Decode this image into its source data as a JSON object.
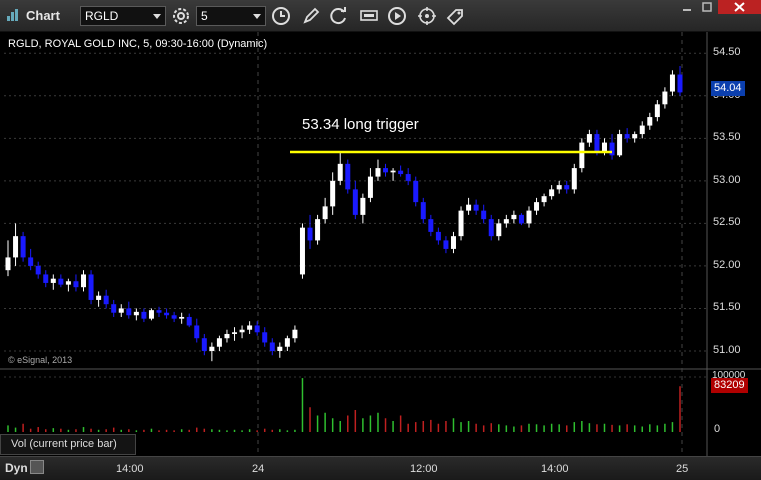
{
  "window": {
    "title": "Chart"
  },
  "toolbar": {
    "symbol": "RGLD",
    "interval": "5"
  },
  "chart": {
    "info": "RGLD, ROYAL GOLD INC, 5, 09:30-16:00 (Dynamic)",
    "annotation": "53.34 long trigger",
    "trigger_price": 53.34,
    "current_price_label": "54.04",
    "copyright": "© eSignal, 2013",
    "price_axis": [
      "54.50",
      "54.00",
      "53.50",
      "53.00",
      "52.50",
      "52.00",
      "51.50",
      "51.00"
    ],
    "time_axis": [
      "14:00",
      "24",
      "12:00",
      "14:00",
      "25"
    ],
    "colors": {
      "up": "#ffffff",
      "down": "#1a1aff",
      "trigger_line": "#ffff00",
      "badge_price": "#0b3fae",
      "badge_volume": "#b00000"
    }
  },
  "volume": {
    "legend": "Vol (current price bar)",
    "axis": [
      "100000",
      "0"
    ],
    "current_label": "83209",
    "colors": {
      "up": "#2fbf2f",
      "down": "#c02020"
    }
  },
  "bottom": {
    "mode": "Dyn"
  },
  "chart_data": {
    "type": "candlestick",
    "series": [
      {
        "name": "RGLD",
        "ohlc": [
          [
            51.95,
            52.3,
            51.88,
            52.1
          ],
          [
            52.1,
            52.5,
            52.0,
            52.35
          ],
          [
            52.35,
            52.4,
            52.05,
            52.1
          ],
          [
            52.1,
            52.2,
            51.95,
            52.0
          ],
          [
            52.0,
            52.05,
            51.85,
            51.9
          ],
          [
            51.9,
            51.95,
            51.75,
            51.8
          ],
          [
            51.8,
            51.9,
            51.72,
            51.85
          ],
          [
            51.85,
            51.9,
            51.75,
            51.78
          ],
          [
            51.78,
            51.85,
            51.7,
            51.82
          ],
          [
            51.82,
            51.9,
            51.7,
            51.75
          ],
          [
            51.75,
            51.95,
            51.7,
            51.9
          ],
          [
            51.9,
            51.95,
            51.55,
            51.6
          ],
          [
            51.6,
            51.7,
            51.52,
            51.65
          ],
          [
            51.65,
            51.72,
            51.5,
            51.55
          ],
          [
            51.55,
            51.6,
            51.4,
            51.45
          ],
          [
            51.45,
            51.55,
            51.4,
            51.5
          ],
          [
            51.5,
            51.58,
            51.38,
            51.42
          ],
          [
            51.42,
            51.5,
            51.36,
            51.46
          ],
          [
            51.46,
            51.5,
            51.34,
            51.38
          ],
          [
            51.38,
            51.5,
            51.36,
            51.48
          ],
          [
            51.48,
            51.52,
            51.4,
            51.45
          ],
          [
            51.45,
            51.5,
            51.38,
            51.42
          ],
          [
            51.42,
            51.46,
            51.34,
            51.38
          ],
          [
            51.38,
            51.45,
            51.32,
            51.4
          ],
          [
            51.4,
            51.44,
            51.28,
            51.3
          ],
          [
            51.3,
            51.38,
            51.1,
            51.15
          ],
          [
            51.15,
            51.2,
            50.95,
            51.0
          ],
          [
            51.0,
            51.1,
            50.88,
            51.05
          ],
          [
            51.05,
            51.18,
            51.0,
            51.15
          ],
          [
            51.15,
            51.25,
            51.1,
            51.2
          ],
          [
            51.2,
            51.28,
            51.12,
            51.22
          ],
          [
            51.22,
            51.3,
            51.15,
            51.25
          ],
          [
            51.25,
            51.35,
            51.2,
            51.3
          ],
          [
            51.3,
            51.35,
            51.18,
            51.22
          ],
          [
            51.22,
            51.28,
            51.05,
            51.1
          ],
          [
            51.1,
            51.15,
            50.95,
            51.0
          ],
          [
            51.0,
            51.1,
            50.92,
            51.05
          ],
          [
            51.05,
            51.18,
            51.0,
            51.15
          ],
          [
            51.15,
            51.3,
            51.1,
            51.25
          ],
          [
            51.9,
            52.5,
            51.85,
            52.45
          ],
          [
            52.45,
            52.6,
            52.2,
            52.3
          ],
          [
            52.3,
            52.6,
            52.25,
            52.55
          ],
          [
            52.55,
            52.8,
            52.5,
            52.7
          ],
          [
            52.7,
            53.1,
            52.6,
            53.0
          ],
          [
            53.0,
            53.35,
            52.95,
            53.2
          ],
          [
            53.2,
            53.25,
            52.85,
            52.9
          ],
          [
            52.9,
            53.0,
            52.55,
            52.6
          ],
          [
            52.6,
            52.85,
            52.5,
            52.8
          ],
          [
            52.8,
            53.15,
            52.75,
            53.05
          ],
          [
            53.05,
            53.25,
            53.0,
            53.15
          ],
          [
            53.15,
            53.2,
            53.05,
            53.1
          ],
          [
            53.1,
            53.15,
            53.0,
            53.12
          ],
          [
            53.12,
            53.18,
            53.05,
            53.08
          ],
          [
            53.08,
            53.15,
            52.95,
            53.0
          ],
          [
            53.0,
            53.05,
            52.7,
            52.75
          ],
          [
            52.75,
            52.8,
            52.5,
            52.55
          ],
          [
            52.55,
            52.6,
            52.35,
            52.4
          ],
          [
            52.4,
            52.45,
            52.25,
            52.3
          ],
          [
            52.3,
            52.35,
            52.15,
            52.2
          ],
          [
            52.2,
            52.4,
            52.15,
            52.35
          ],
          [
            52.35,
            52.7,
            52.3,
            52.65
          ],
          [
            52.65,
            52.8,
            52.6,
            52.72
          ],
          [
            52.72,
            52.78,
            52.6,
            52.65
          ],
          [
            52.65,
            52.72,
            52.5,
            52.55
          ],
          [
            52.55,
            52.6,
            52.3,
            52.35
          ],
          [
            52.35,
            52.55,
            52.3,
            52.5
          ],
          [
            52.5,
            52.6,
            52.45,
            52.55
          ],
          [
            52.55,
            52.65,
            52.5,
            52.6
          ],
          [
            52.6,
            52.62,
            52.48,
            52.5
          ],
          [
            52.5,
            52.7,
            52.45,
            52.65
          ],
          [
            52.65,
            52.8,
            52.6,
            52.75
          ],
          [
            52.75,
            52.85,
            52.7,
            52.82
          ],
          [
            52.82,
            52.95,
            52.78,
            52.9
          ],
          [
            52.9,
            53.0,
            52.85,
            52.95
          ],
          [
            52.95,
            53.0,
            52.85,
            52.9
          ],
          [
            52.9,
            53.2,
            52.85,
            53.15
          ],
          [
            53.15,
            53.5,
            53.1,
            53.45
          ],
          [
            53.45,
            53.6,
            53.4,
            53.55
          ],
          [
            53.55,
            53.6,
            53.3,
            53.35
          ],
          [
            53.35,
            53.5,
            53.3,
            53.45
          ],
          [
            53.45,
            53.55,
            53.25,
            53.3
          ],
          [
            53.3,
            53.6,
            53.28,
            53.55
          ],
          [
            53.55,
            53.62,
            53.45,
            53.5
          ],
          [
            53.5,
            53.58,
            53.45,
            53.55
          ],
          [
            53.55,
            53.7,
            53.5,
            53.65
          ],
          [
            53.65,
            53.8,
            53.6,
            53.75
          ],
          [
            53.75,
            53.95,
            53.7,
            53.9
          ],
          [
            53.9,
            54.1,
            53.85,
            54.05
          ],
          [
            54.05,
            54.3,
            54.0,
            54.25
          ],
          [
            54.25,
            54.35,
            54.0,
            54.04
          ]
        ]
      }
    ],
    "volume": [
      12000,
      8000,
      15000,
      6000,
      9000,
      5000,
      7000,
      6000,
      4000,
      5000,
      9000,
      6000,
      4000,
      5000,
      8000,
      4000,
      5000,
      3000,
      4000,
      6000,
      3000,
      4000,
      3000,
      5000,
      4000,
      8000,
      6000,
      5000,
      4000,
      3000,
      4000,
      3000,
      5000,
      3000,
      6000,
      4000,
      5000,
      3000,
      4000,
      98000,
      45000,
      30000,
      35000,
      25000,
      20000,
      30000,
      40000,
      25000,
      30000,
      35000,
      25000,
      20000,
      30000,
      15000,
      18000,
      20000,
      22000,
      15000,
      20000,
      25000,
      18000,
      20000,
      15000,
      12000,
      16000,
      14000,
      12000,
      10000,
      12000,
      15000,
      14000,
      12000,
      15000,
      14000,
      12000,
      18000,
      20000,
      16000,
      14000,
      15000,
      13000,
      12000,
      14000,
      12000,
      10000,
      14000,
      12000,
      15000,
      18000,
      83209
    ],
    "price_ylim": [
      50.8,
      54.75
    ],
    "volume_ylim": [
      0,
      100000
    ]
  }
}
